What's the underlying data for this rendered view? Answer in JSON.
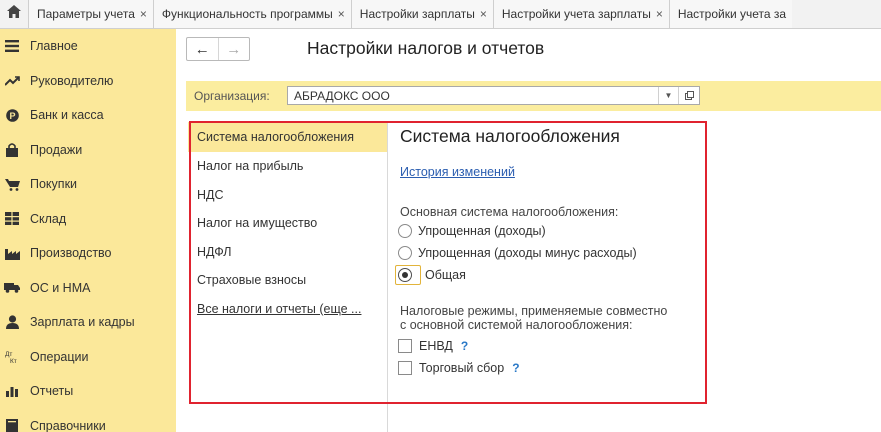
{
  "tabs": [
    {
      "label": "Параметры учета",
      "close": "×"
    },
    {
      "label": "Функциональность программы",
      "close": "×"
    },
    {
      "label": "Настройки зарплаты",
      "close": "×"
    },
    {
      "label": "Настройки учета зарплаты",
      "close": "×"
    },
    {
      "label": "Настройки учета за",
      "close": ""
    }
  ],
  "sidebar": {
    "items": [
      {
        "label": "Главное",
        "icon": "menu-icon"
      },
      {
        "label": "Руководителю",
        "icon": "trend-icon"
      },
      {
        "label": "Банк и касса",
        "icon": "coin-icon"
      },
      {
        "label": "Продажи",
        "icon": "bag-icon"
      },
      {
        "label": "Покупки",
        "icon": "cart-icon"
      },
      {
        "label": "Склад",
        "icon": "warehouse-icon"
      },
      {
        "label": "Производство",
        "icon": "factory-icon"
      },
      {
        "label": "ОС и НМА",
        "icon": "truck-icon"
      },
      {
        "label": "Зарплата и кадры",
        "icon": "person-icon"
      },
      {
        "label": "Операции",
        "icon": "dt-kt-icon"
      },
      {
        "label": "Отчеты",
        "icon": "bar-chart-icon"
      },
      {
        "label": "Справочники",
        "icon": "book-icon"
      }
    ]
  },
  "header": {
    "title": "Настройки налогов и отчетов",
    "back": "←",
    "forward": "→"
  },
  "organization": {
    "label": "Организация:",
    "value": "АБРАДОКС ООО"
  },
  "sections": [
    {
      "label": "Система налогообложения",
      "active": true
    },
    {
      "label": "Налог на прибыль"
    },
    {
      "label": "НДС"
    },
    {
      "label": "Налог на имущество"
    },
    {
      "label": "НДФЛ"
    },
    {
      "label": "Страховые взносы"
    },
    {
      "label": "Все налоги и отчеты (еще ...",
      "link": true
    }
  ],
  "content": {
    "title": "Система налогообложения",
    "history_link": "История изменений",
    "main_system_label": "Основная система налогообложения:",
    "options": [
      {
        "label": "Упрощенная (доходы)",
        "selected": false
      },
      {
        "label": "Упрощенная (доходы минус расходы)",
        "selected": false
      },
      {
        "label": "Общая",
        "selected": true
      }
    ],
    "regimes_label_1": "Налоговые режимы, применяемые совместно",
    "regimes_label_2": "с основной системой налогообложения:",
    "regimes": [
      {
        "label": "ЕНВД",
        "checked": false,
        "help": "?"
      },
      {
        "label": "Торговый сбор",
        "checked": false,
        "help": "?"
      }
    ]
  },
  "colors": {
    "sidebar_bg": "#fbe89a",
    "highlight_border": "#e0232f",
    "link": "#2a5db0",
    "help": "#2a79c7"
  }
}
